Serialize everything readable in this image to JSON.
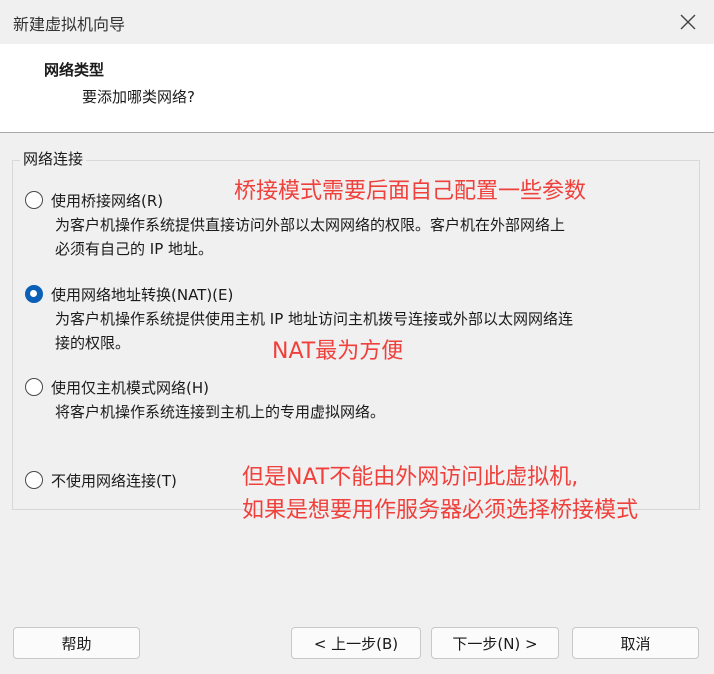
{
  "window": {
    "title": "新建虚拟机向导"
  },
  "header": {
    "title": "网络类型",
    "subtitle": "要添加哪类网络?"
  },
  "group": {
    "label": "网络连接"
  },
  "options": [
    {
      "label": "使用桥接网络(R)",
      "desc1": "为客户机操作系统提供直接访问外部以太网网络的权限。客户机在外部网络上",
      "desc2": "必须有自己的 IP 地址。",
      "checked": false
    },
    {
      "label": "使用网络地址转换(NAT)(E)",
      "desc1": "为客户机操作系统提供使用主机 IP 地址访问主机拨号连接或外部以太网网络连",
      "desc2": "接的权限。",
      "checked": true
    },
    {
      "label": "使用仅主机模式网络(H)",
      "desc1": "将客户机操作系统连接到主机上的专用虚拟网络。",
      "checked": false
    },
    {
      "label": "不使用网络连接(T)",
      "checked": false
    }
  ],
  "annotations": {
    "bridge": "桥接模式需要后面自己配置一些参数",
    "nat": "NAT最为方便",
    "note_line1": "但是NAT不能由外网访问此虚拟机,",
    "note_line2": "如果是想要用作服务器必须选择桥接模式"
  },
  "buttons": {
    "help": "帮助",
    "back": "< 上一步(B)",
    "next": "下一步(N) >",
    "cancel": "取消"
  },
  "colors": {
    "annotation": "#f0403c",
    "radio_checked": "#0a5fb6"
  }
}
